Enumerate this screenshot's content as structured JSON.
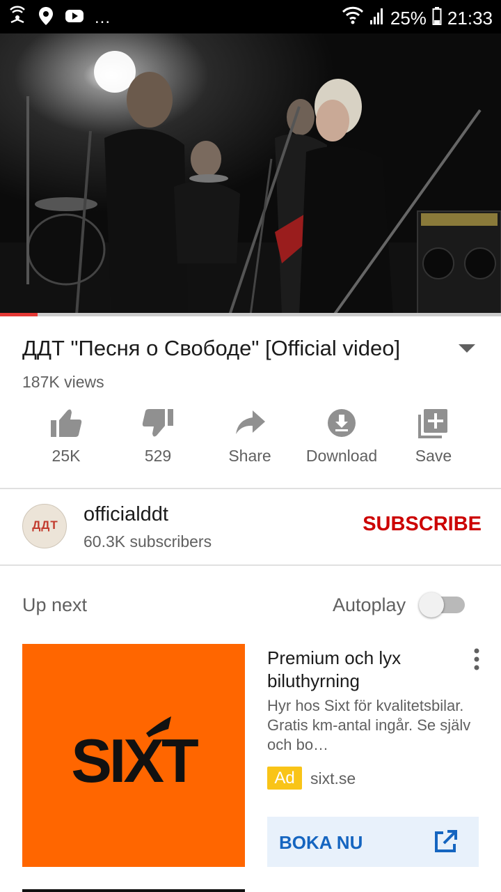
{
  "status_bar": {
    "notification_icons": [
      "wifi-hotspot-icon",
      "location-pin-icon",
      "youtube-icon"
    ],
    "more_indicator": "...",
    "battery": "25%",
    "time": "21:33"
  },
  "player": {
    "progress_fraction": 0.075
  },
  "video": {
    "title": "ДДТ \"Песня о Свободе\" [Official video]",
    "views": "187K views"
  },
  "actions": [
    {
      "icon": "thumbs-up-icon",
      "label": "25K"
    },
    {
      "icon": "thumbs-down-icon",
      "label": "529"
    },
    {
      "icon": "share-arrow-icon",
      "label": "Share"
    },
    {
      "icon": "download-icon",
      "label": "Download"
    },
    {
      "icon": "save-playlist-icon",
      "label": "Save"
    }
  ],
  "channel": {
    "avatar_text": "ДДТ",
    "name": "officialddt",
    "subscribers": "60.3K subscribers",
    "subscribe_label": "SUBSCRIBE"
  },
  "up_next": {
    "label": "Up next",
    "autoplay_label": "Autoplay",
    "autoplay_on": false
  },
  "ad": {
    "logo_text": "SIXT",
    "title": "Premium och lyx biluthyrning",
    "description": "Hyr hos Sixt för kvalitetsbilar. Gratis km-antal ingår. Se själv och bo…",
    "badge": "Ad",
    "domain": "sixt.se",
    "cta_label": "BOKA NU",
    "colors": {
      "background": "#ff6600",
      "badge": "#f9c418",
      "cta_text": "#1565c0"
    }
  }
}
